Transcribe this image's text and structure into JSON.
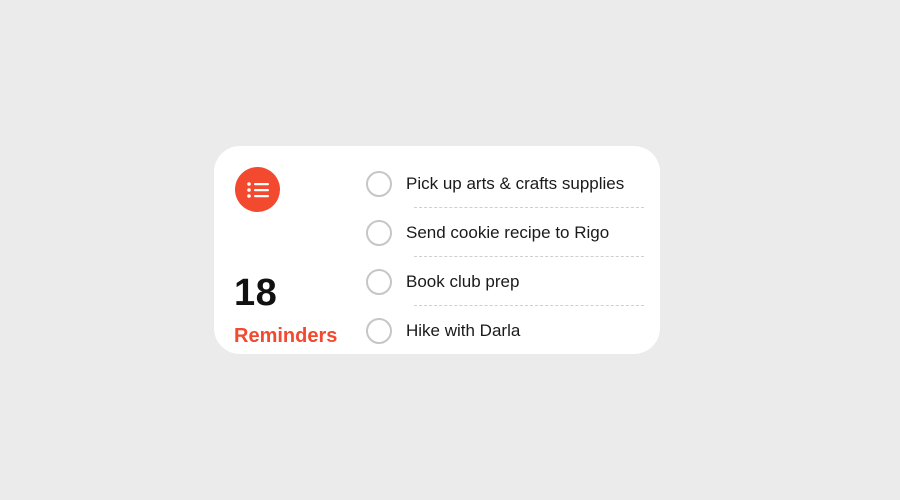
{
  "widget": {
    "icon": "list-icon",
    "count": "18",
    "list_name": "Reminders",
    "accent_color": "#f2492f",
    "tasks": [
      {
        "title": "Pick up arts & crafts supplies",
        "completed": false
      },
      {
        "title": "Send cookie recipe to Rigo",
        "completed": false
      },
      {
        "title": "Book club prep",
        "completed": false
      },
      {
        "title": "Hike with Darla",
        "completed": false
      }
    ]
  }
}
